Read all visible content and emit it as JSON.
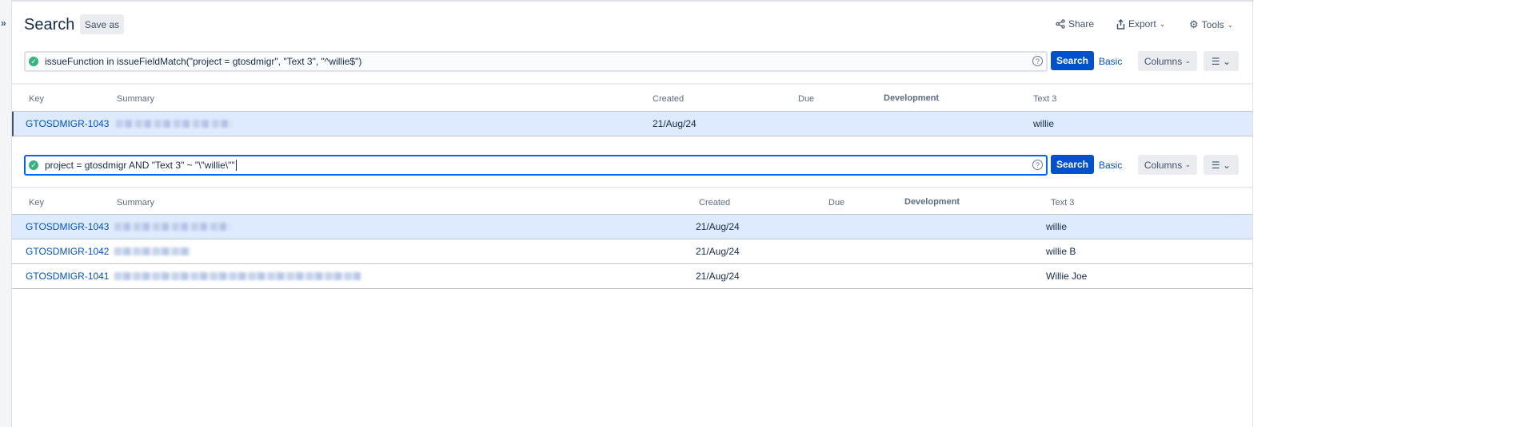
{
  "header": {
    "title": "Search",
    "save_as": "Save as",
    "share": "Share",
    "export": "Export",
    "tools": "Tools"
  },
  "icons": {
    "expand": "chevron-double-right-icon",
    "share": "share-icon",
    "export": "export-icon",
    "tools": "gear-icon",
    "valid": "check-circle-icon",
    "help": "question-circle-icon",
    "menu": "hamburger-icon"
  },
  "colors": {
    "accent": "#0052cc",
    "selected_row": "#deebff",
    "valid": "#36b37e"
  },
  "search1": {
    "query": "issueFunction in issueFieldMatch(\"project = gtosdmigr\", \"Text 3\", \"^willie$\")",
    "search": "Search",
    "basic": "Basic",
    "columns": "Columns",
    "headers": {
      "key": "Key",
      "summary": "Summary",
      "created": "Created",
      "due": "Due",
      "development": "Development",
      "text3": "Text 3"
    },
    "rows": [
      {
        "key": "GTOSDMIGR-1043",
        "created": "21/Aug/24",
        "text3": "willie"
      }
    ]
  },
  "search2": {
    "query": "project = gtosdmigr AND \"Text 3\" ~ \"\\\"willie\\\"\"",
    "search": "Search",
    "basic": "Basic",
    "columns": "Columns",
    "headers": {
      "key": "Key",
      "summary": "Summary",
      "created": "Created",
      "due": "Due",
      "development": "Development",
      "text3": "Text 3"
    },
    "rows": [
      {
        "key": "GTOSDMIGR-1043",
        "created": "21/Aug/24",
        "text3": "willie"
      },
      {
        "key": "GTOSDMIGR-1042",
        "created": "21/Aug/24",
        "text3": "willie B"
      },
      {
        "key": "GTOSDMIGR-1041",
        "created": "21/Aug/24",
        "text3": "Willie Joe"
      }
    ]
  }
}
